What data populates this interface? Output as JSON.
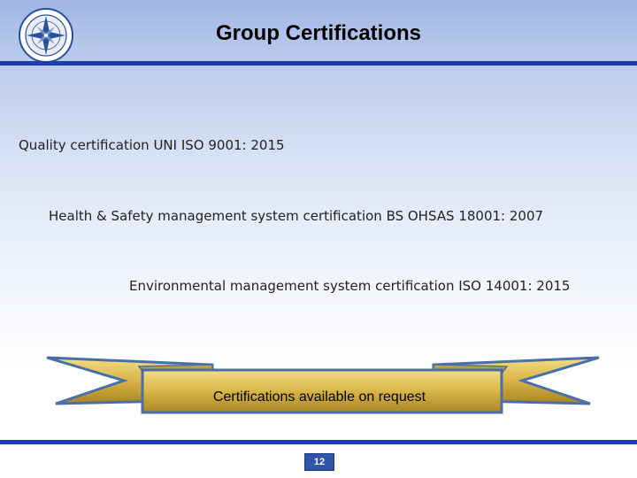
{
  "header": {
    "title": "Group Certifications",
    "logo": {
      "icon": "compass-rose-logo-icon"
    }
  },
  "certifications": [
    {
      "label": "Quality certification UNI ISO 9001: 2015"
    },
    {
      "label": "Health & Safety management system certification BS OHSAS 18001: 2007"
    },
    {
      "label": "Environmental management system certification ISO 14001: 2015"
    }
  ],
  "banner": {
    "text": "Certifications available on request"
  },
  "footer": {
    "page_number": "12"
  },
  "colors": {
    "rule": "#1a3fa8",
    "ribbon_gold": "#d9b548",
    "ribbon_border": "#4a6fa8",
    "badge": "#2f54a8"
  }
}
